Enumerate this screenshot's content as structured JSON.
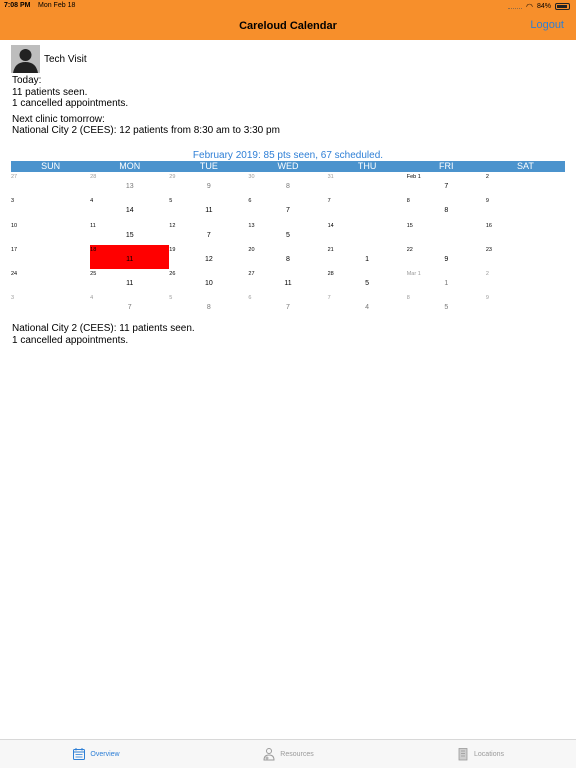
{
  "status": {
    "time": "7:08 PM",
    "date": "Mon Feb 18",
    "battery": "84%"
  },
  "header": {
    "title": "Careloud Calendar",
    "logout_label": "Logout"
  },
  "visit": {
    "label": "Tech Visit"
  },
  "summary": {
    "today_label": "Today:",
    "seen": "11 patients seen.",
    "cancelled": "1 cancelled appointments.",
    "next_label": "Next clinic tomorrow:",
    "next_detail": "National City 2 (CEES): 12 patients from 8:30 am to 3:30 pm"
  },
  "calendar": {
    "title": "February 2019: 85 pts seen, 67 scheduled.",
    "days": [
      "SUN",
      "MON",
      "TUE",
      "WED",
      "THU",
      "FRI",
      "SAT"
    ],
    "selected_color": "#ff0000",
    "weeks": [
      [
        {
          "date": "27",
          "count": "",
          "dim": true
        },
        {
          "date": "28",
          "count": "13",
          "dim": true
        },
        {
          "date": "29",
          "count": "9",
          "dim": true
        },
        {
          "date": "30",
          "count": "8",
          "dim": true
        },
        {
          "date": "31",
          "count": "",
          "dim": true
        },
        {
          "date": "Feb 1",
          "count": "7",
          "dim": false
        },
        {
          "date": "2",
          "count": "",
          "dim": false
        }
      ],
      [
        {
          "date": "3",
          "count": "",
          "dim": false
        },
        {
          "date": "4",
          "count": "14",
          "dim": false
        },
        {
          "date": "5",
          "count": "11",
          "dim": false
        },
        {
          "date": "6",
          "count": "7",
          "dim": false
        },
        {
          "date": "7",
          "count": "",
          "dim": false
        },
        {
          "date": "8",
          "count": "8",
          "dim": false
        },
        {
          "date": "9",
          "count": "",
          "dim": false
        }
      ],
      [
        {
          "date": "10",
          "count": "",
          "dim": false
        },
        {
          "date": "11",
          "count": "15",
          "dim": false
        },
        {
          "date": "12",
          "count": "7",
          "dim": false
        },
        {
          "date": "13",
          "count": "5",
          "dim": false
        },
        {
          "date": "14",
          "count": "",
          "dim": false
        },
        {
          "date": "15",
          "count": "",
          "dim": false
        },
        {
          "date": "16",
          "count": "",
          "dim": false
        }
      ],
      [
        {
          "date": "17",
          "count": "",
          "dim": false
        },
        {
          "date": "18",
          "count": "11",
          "dim": false,
          "selected": true
        },
        {
          "date": "19",
          "count": "12",
          "dim": false
        },
        {
          "date": "20",
          "count": "8",
          "dim": false
        },
        {
          "date": "21",
          "count": "1",
          "dim": false
        },
        {
          "date": "22",
          "count": "9",
          "dim": false
        },
        {
          "date": "23",
          "count": "",
          "dim": false
        }
      ],
      [
        {
          "date": "24",
          "count": "",
          "dim": false
        },
        {
          "date": "25",
          "count": "11",
          "dim": false
        },
        {
          "date": "26",
          "count": "10",
          "dim": false
        },
        {
          "date": "27",
          "count": "11",
          "dim": false
        },
        {
          "date": "28",
          "count": "5",
          "dim": false
        },
        {
          "date": "Mar 1",
          "count": "1",
          "dim": true
        },
        {
          "date": "2",
          "count": "",
          "dim": true
        }
      ],
      [
        {
          "date": "3",
          "count": "",
          "dim": true
        },
        {
          "date": "4",
          "count": "7",
          "dim": true
        },
        {
          "date": "5",
          "count": "8",
          "dim": true
        },
        {
          "date": "6",
          "count": "7",
          "dim": true
        },
        {
          "date": "7",
          "count": "4",
          "dim": true
        },
        {
          "date": "8",
          "count": "5",
          "dim": true
        },
        {
          "date": "9",
          "count": "",
          "dim": true
        }
      ]
    ]
  },
  "day_summary": {
    "clinic": "National City 2 (CEES): 11 patients seen.",
    "cancelled": "1 cancelled appointments."
  },
  "tabs": [
    {
      "label": "Overview",
      "icon": "calendar-icon",
      "active": true
    },
    {
      "label": "Resources",
      "icon": "doctor-icon",
      "active": false
    },
    {
      "label": "Locations",
      "icon": "building-icon",
      "active": false
    }
  ]
}
